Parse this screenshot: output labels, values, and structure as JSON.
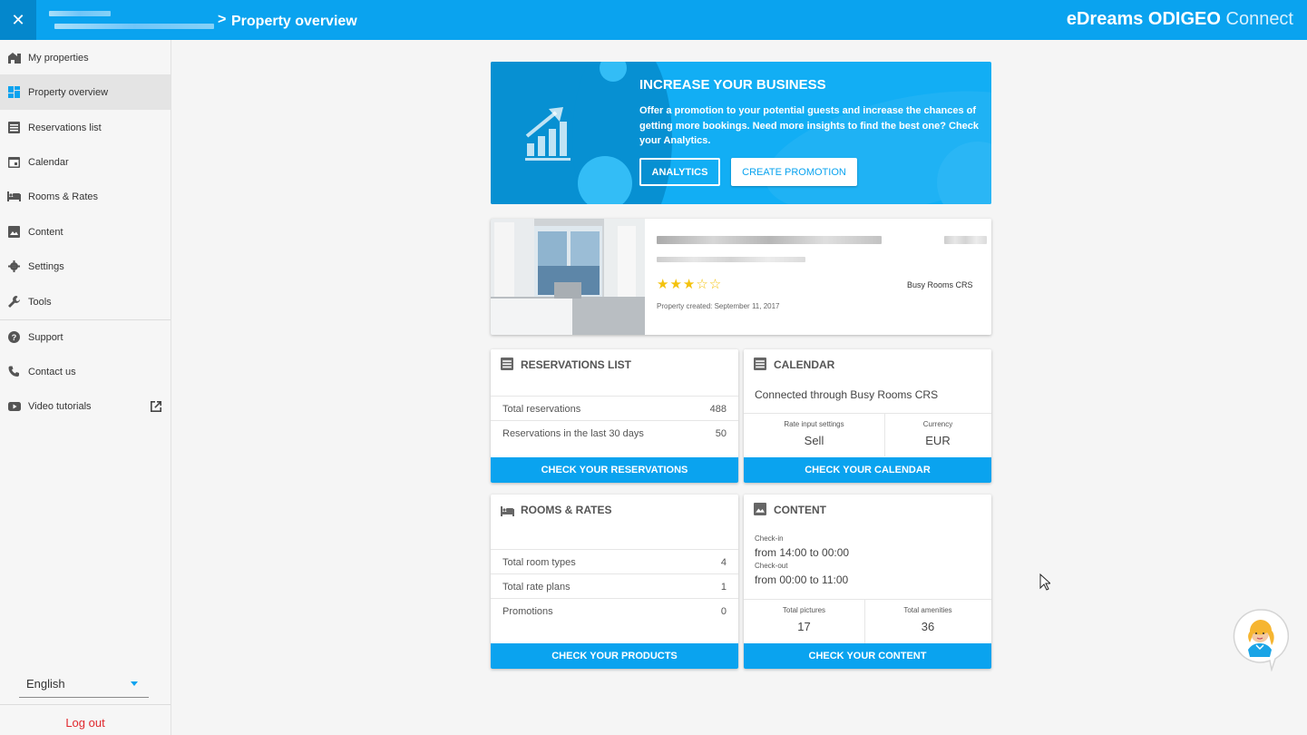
{
  "header": {
    "close_label": "✕",
    "separator": ">",
    "page_title": "Property overview",
    "brand_bold": "eDreams ODIGEO",
    "brand_light": "Connect"
  },
  "sidebar": {
    "items": [
      {
        "label": "My properties",
        "icon": "building-icon"
      },
      {
        "label": "Property overview",
        "icon": "dashboard-icon"
      },
      {
        "label": "Reservations list",
        "icon": "list-icon"
      },
      {
        "label": "Calendar",
        "icon": "calendar-icon"
      },
      {
        "label": "Rooms & Rates",
        "icon": "bed-icon"
      },
      {
        "label": "Content",
        "icon": "image-icon"
      },
      {
        "label": "Settings",
        "icon": "gear-icon"
      },
      {
        "label": "Tools",
        "icon": "wrench-icon"
      },
      {
        "label": "Support",
        "icon": "help-icon"
      },
      {
        "label": "Contact us",
        "icon": "phone-icon"
      },
      {
        "label": "Video tutorials",
        "icon": "youtube-icon"
      }
    ],
    "language": "English",
    "logout": "Log out"
  },
  "promo": {
    "title": "INCREASE YOUR BUSINESS",
    "text": "Offer a promotion to your potential guests and increase the chances of getting more bookings. Need more insights to find the best one? Check your Analytics.",
    "analytics_btn": "ANALYTICS",
    "create_btn": "CREATE PROMOTION"
  },
  "property": {
    "stars_full": "★★★",
    "stars_empty": "☆☆",
    "rating": 3,
    "rating_max": 5,
    "crs": "Busy Rooms CRS",
    "created": "Property created: September 11, 2017"
  },
  "reservations": {
    "title": "RESERVATIONS LIST",
    "rows": [
      {
        "label": "Total reservations",
        "value": "488"
      },
      {
        "label": "Reservations in the last 30 days",
        "value": "50"
      }
    ],
    "button": "CHECK YOUR RESERVATIONS"
  },
  "calendar": {
    "title": "CALENDAR",
    "connected": "Connected through Busy Rooms CRS",
    "rate_label": "Rate input settings",
    "rate_value": "Sell",
    "currency_label": "Currency",
    "currency_value": "EUR",
    "button": "CHECK YOUR CALENDAR"
  },
  "rooms": {
    "title": "ROOMS & RATES",
    "rows": [
      {
        "label": "Total room types",
        "value": "4"
      },
      {
        "label": "Total rate plans",
        "value": "1"
      },
      {
        "label": "Promotions",
        "value": "0"
      }
    ],
    "button": "CHECK YOUR PRODUCTS"
  },
  "content": {
    "title": "CONTENT",
    "checkin_label": "Check-in",
    "checkin_value": "from 14:00 to 00:00",
    "checkout_label": "Check-out",
    "checkout_value": "from 00:00 to 11:00",
    "pictures_label": "Total pictures",
    "pictures_value": "17",
    "amenities_label": "Total amenities",
    "amenities_value": "36",
    "button": "CHECK YOUR CONTENT"
  },
  "colors": {
    "accent": "#0aa3ef",
    "accent_dark": "#0487cc",
    "logout": "#e0282e",
    "star": "#f4c20d"
  }
}
